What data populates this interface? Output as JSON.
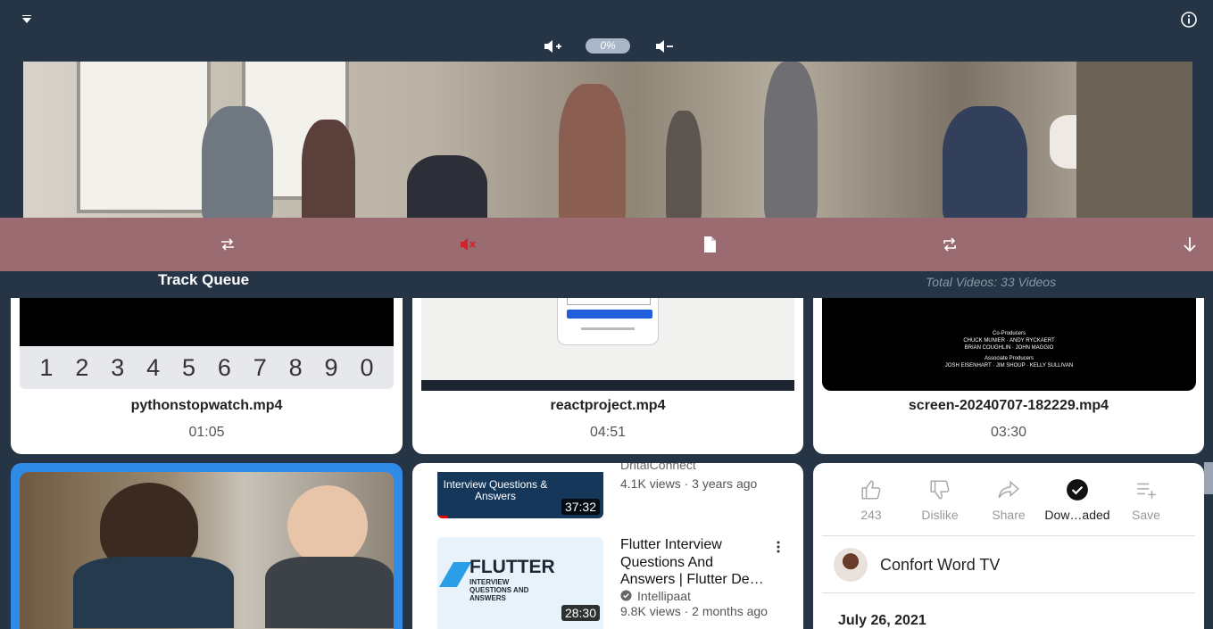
{
  "volume": {
    "level_label": "0%"
  },
  "queue": {
    "title": "Track Queue",
    "total": "Total Videos: 33 Videos"
  },
  "cards": [
    {
      "name": "pythonstopwatch.mp4",
      "duration": "01:05",
      "keys": [
        "1",
        "2",
        "3",
        "4",
        "5",
        "6",
        "7",
        "8",
        "9",
        "0"
      ]
    },
    {
      "name": "reactproject.mp4",
      "duration": "04:51"
    },
    {
      "name": "screen-20240707-182229.mp4",
      "duration": "03:30",
      "credits": [
        "Co-Producers",
        "CHUCK MUNIER · ANDY RYCKAERT",
        "BRIAN COUGHLIN · JOHN MAGGIO",
        "Associate Producers",
        "JOSH EISENHART · JIM SHOUP · KELLY SULLIVAN"
      ]
    }
  ],
  "youtube": {
    "item1": {
      "thumb_text": "Interview Questions & Answers",
      "duration": "37:32",
      "channel": "DritalConnect",
      "meta": "4.1K views · 3 years ago"
    },
    "item2": {
      "thumb_text": "FLUTTER",
      "thumb_sub": "INTERVIEW QUESTIONS AND ANSWERS",
      "duration": "28:30",
      "title": "Flutter Interview Questions And Answers | Flutter De…",
      "channel": "Intellipaat",
      "meta": "9.8K views · 2 months ago"
    }
  },
  "actions": {
    "likes": "243",
    "dislike": "Dislike",
    "share": "Share",
    "download": "Dow…aded",
    "save": "Save"
  },
  "channel": {
    "name": "Confort Word TV",
    "date": "July 26, 2021"
  },
  "colors": {
    "background": "#253545",
    "controls": "#9a6b71",
    "mute_red": "#d2232a",
    "selected": "#2f8be6"
  }
}
